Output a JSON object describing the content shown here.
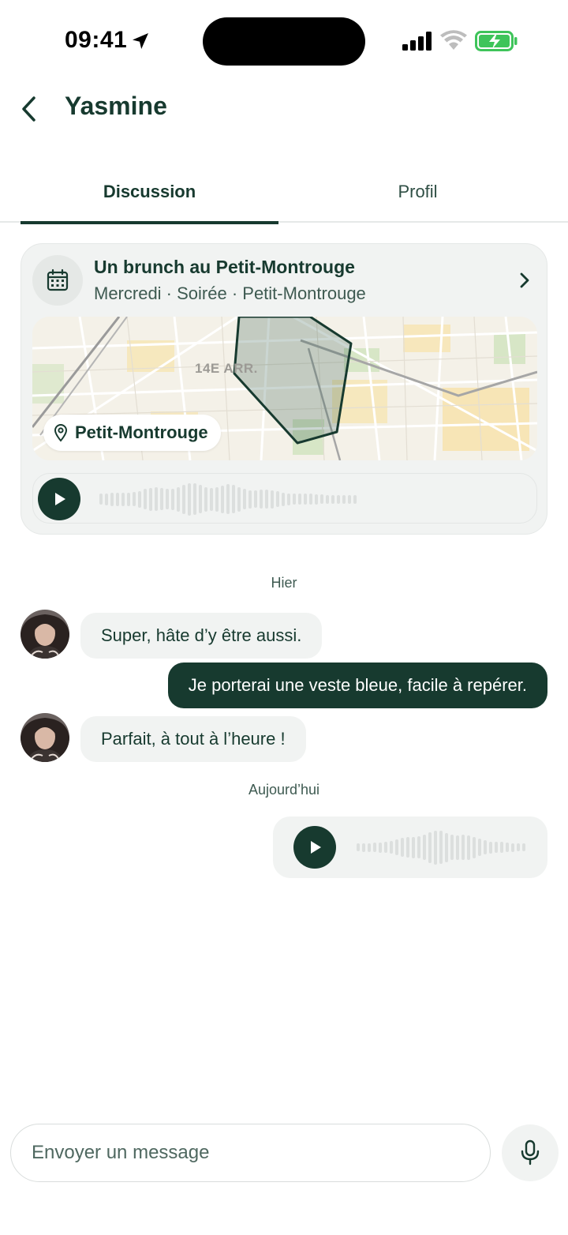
{
  "status_bar": {
    "time": "09:41",
    "icons": [
      "location-arrow-icon",
      "cellular-signal-icon",
      "wifi-icon",
      "battery-charging-icon"
    ],
    "battery_color": "#3ec45a"
  },
  "header": {
    "back_icon": "chevron-left-icon",
    "title": "Yasmine"
  },
  "tabs": [
    {
      "label": "Discussion",
      "active": true
    },
    {
      "label": "Profil",
      "active": false
    }
  ],
  "plan_card": {
    "icon": "calendar-icon",
    "title": "Un brunch au Petit-Montrouge",
    "subtitle": "Mercredi · Soirée · Petit-Montrouge",
    "chevron_icon": "chevron-right-icon",
    "map": {
      "district_label": "14E ARR.",
      "pin_icon": "map-pin-icon",
      "place_label": "Petit-Montrouge"
    },
    "audio": {
      "play_icon": "play-icon"
    }
  },
  "conversation": {
    "day_1": "Hier",
    "messages_day_1": [
      {
        "from": "Yasmine",
        "direction": "in",
        "text": "Super, hâte d’y être aussi."
      },
      {
        "from": "me",
        "direction": "out",
        "text": "Je porterai une veste bleue, facile à repérer."
      },
      {
        "from": "Yasmine",
        "direction": "in",
        "text": "Parfait, à tout à l’heure !"
      }
    ],
    "day_2": "Aujourd’hui",
    "messages_day_2": [
      {
        "from": "me",
        "direction": "out",
        "type": "voice",
        "play_icon": "play-icon"
      }
    ]
  },
  "composer": {
    "placeholder": "Envoyer un message",
    "value": "",
    "mic_icon": "microphone-icon"
  },
  "colors": {
    "brand_dark_green": "#173a2f",
    "bubble_light": "#f1f3f2",
    "text_secondary": "#3e5a51"
  }
}
